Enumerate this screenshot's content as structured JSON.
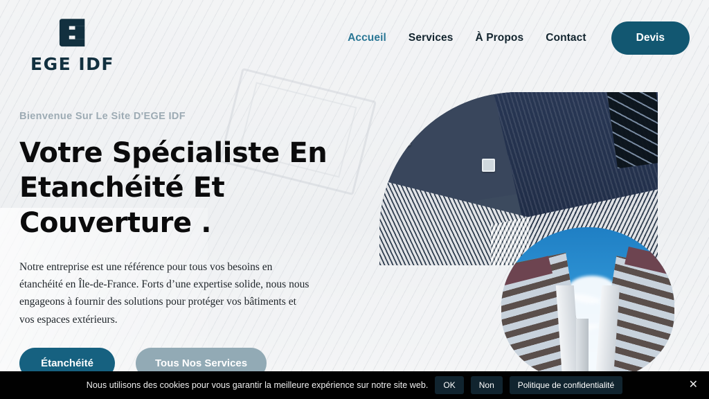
{
  "brand": {
    "logo_icon": "ege-monogram-icon",
    "name": "EGE  IDF"
  },
  "nav": {
    "items": [
      {
        "label": "Accueil",
        "active": true
      },
      {
        "label": "Services",
        "active": false
      },
      {
        "label": "À Propos",
        "active": false
      },
      {
        "label": "Contact",
        "active": false
      }
    ],
    "cta_label": "Devis"
  },
  "hero": {
    "eyebrow": "Bienvenue Sur Le Site D'EGE IDF",
    "title": "Votre Spécialiste En Etanchéité Et Couverture .",
    "paragraph": "Notre entreprise est une référence pour tous vos besoins en étanchéité en Île-de-France. Forts d’une expertise solide, nous nous engageons à fournir des solutions pour protéger vos bâtiments et vos espaces extérieurs.",
    "primary_cta": "Étanchéité",
    "secondary_cta": "Tous Nos Services",
    "image_top_alt": "metal-roof-aerial-image",
    "image_bottom_alt": "buildings-looking-up-sky-image"
  },
  "cookie_banner": {
    "message": "Nous utilisons des cookies pour vous garantir la meilleure expérience sur notre site web.",
    "accept_label": "OK",
    "decline_label": "Non",
    "policy_label": "Politique de confidentialité",
    "close_icon": "close-icon",
    "close_glyph": "✕"
  },
  "colors": {
    "brand_dark": "#12303f",
    "accent_teal": "#166180",
    "nav_active": "#2a7795",
    "secondary_btn": "#92aab5",
    "eyebrow": "#9dabb4",
    "page_bg": "#f2f3f5",
    "banner_bg": "#010101"
  }
}
